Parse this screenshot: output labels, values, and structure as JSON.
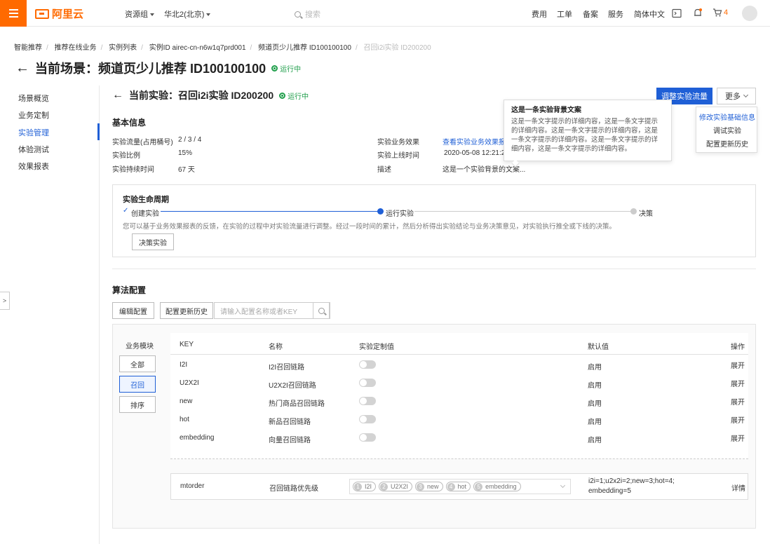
{
  "topbar": {
    "brand": "阿里云",
    "resource_group": "资源组",
    "region": "华北2(北京)",
    "search_placeholder": "搜索",
    "links": [
      "费用",
      "工单",
      "备案",
      "服务",
      "简体中文"
    ],
    "cart_count": "4"
  },
  "breadcrumb": {
    "items": [
      "智能推荐",
      "推荐在线业务",
      "实例列表",
      "实例ID airec-cn-n6w1q7prd001",
      "频道页少儿推荐 ID100100100"
    ],
    "current": "召回i2i实验 ID200200"
  },
  "page": {
    "title": "当前场景：频道页少儿推荐 ID100100100",
    "status": "运行中"
  },
  "sidenav": {
    "items": [
      "场景概览",
      "业务定制",
      "实验管理",
      "体验测试",
      "效果报表"
    ],
    "active": "实验管理"
  },
  "experiment": {
    "title": "当前实验：召回i2i实验 ID200200",
    "status": "运行中",
    "primary_button": "调整实验流量",
    "more_button": "更多",
    "more_menu": [
      "修改实验基础信息",
      "调试实验",
      "配置更新历史"
    ]
  },
  "basic_info": {
    "title": "基本信息",
    "traffic_label": "实验流量(占用桶号)",
    "traffic_value": "2 / 3 / 4",
    "ratio_label": "实验比例",
    "ratio_value": "15%",
    "duration_label": "实验持续时间",
    "duration_value": "67 天",
    "effect_label": "实验业务效果",
    "effect_link": "查看实验业务效果报表",
    "online_label": "实验上线时间",
    "online_value": "2020-05-08 12:21:2",
    "desc_label": "描述",
    "desc_value": "这是一个实验背景的文案..."
  },
  "tooltip": {
    "title": "这是一条实验背景文案",
    "body": "这是一条文字提示的详细内容，这是一条文字提示的详细内容。这是一条文字提示的详细内容，这是一条文字提示的详细内容。这是一条文字提示的详细内容，这是一条文字提示的详细内容。"
  },
  "lifecycle": {
    "title": "实验生命周期",
    "steps": [
      "创建实验",
      "运行实验",
      "决策"
    ],
    "description": "您可以基于业务效果报表的反馈，在实验的过程中对实验流量进行调整。经过一段时间的累计，然后分析得出实验结论与业务决策意见，对实验执行推全或下线的决策。",
    "decide_button": "决策实验"
  },
  "algo": {
    "title": "算法配置",
    "edit_button": "编辑配置",
    "history_button": "配置更新历史",
    "search_placeholder": "请输入配置名称或者KEY",
    "module_title": "业务模块",
    "modules": [
      "全部",
      "召回",
      "排序"
    ],
    "selected_module": "召回",
    "columns": [
      "KEY",
      "名称",
      "实验定制值",
      "默认值",
      "操作"
    ],
    "rows": [
      {
        "key": "I2I",
        "name": "I2I召回链路",
        "default": "启用",
        "action": "展开"
      },
      {
        "key": "U2X2I",
        "name": "U2X2I召回链路",
        "default": "启用",
        "action": "展开"
      },
      {
        "key": "new",
        "name": "热门商品召回链路",
        "default": "启用",
        "action": "展开"
      },
      {
        "key": "hot",
        "name": "新品召回链路",
        "default": "启用",
        "action": "展开"
      },
      {
        "key": "embedding",
        "name": "向量召回链路",
        "default": "启用",
        "action": "展开"
      }
    ],
    "mtorder": {
      "key": "mtorder",
      "name": "召回链路优先级",
      "tags": [
        {
          "num": "1",
          "label": "I2I"
        },
        {
          "num": "2",
          "label": "U2X2I"
        },
        {
          "num": "3",
          "label": "new"
        },
        {
          "num": "4",
          "label": "hot"
        },
        {
          "num": "5",
          "label": "embedding"
        }
      ],
      "default_line1": "i2i=1;u2x2i=2;new=3;hot=4;",
      "default_line2": "embedding=5",
      "action": "详情"
    }
  },
  "colors": {
    "brand_orange": "#ff6a00",
    "primary_blue": "#1f5fd6",
    "running_green": "#1e9e4a"
  }
}
